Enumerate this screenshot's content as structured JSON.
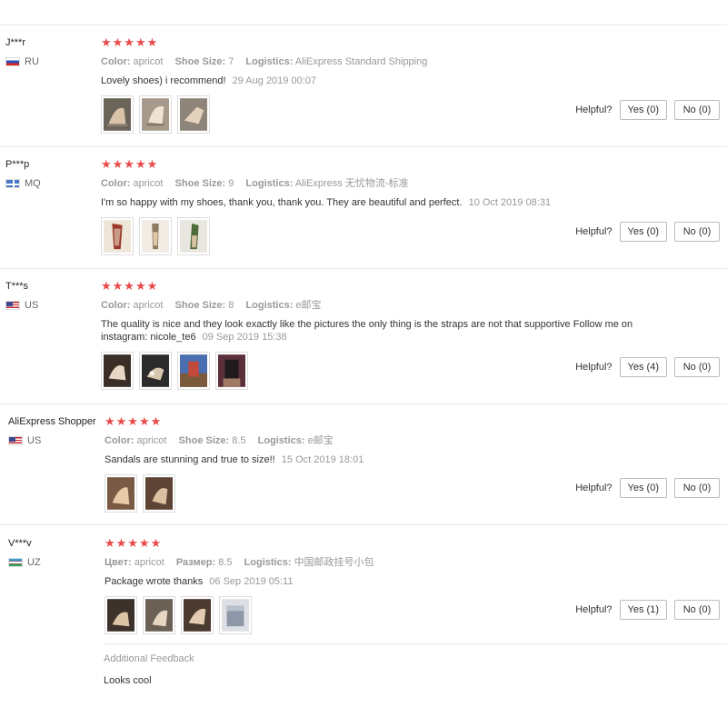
{
  "helpful_label": "Helpful?",
  "colors": {
    "star": "#e94a4a",
    "border": "#e8e8e8",
    "muted": "#999999"
  },
  "reviews": [
    {
      "user": "J***r",
      "country": "RU",
      "flag": "ru",
      "stars": "★★★★★",
      "attrs": [
        {
          "k": "Color:",
          "v": "apricot"
        },
        {
          "k": "Shoe Size:",
          "v": "7"
        },
        {
          "k": "Logistics:",
          "v": "AliExpress Standard Shipping"
        }
      ],
      "text": "Lovely shoes) i recommend!",
      "time": "29 Aug 2019 00:07",
      "photos": [
        "shoe-photo",
        "shoe-photo",
        "shoe-photo"
      ],
      "yes": "Yes (0)",
      "no": "No (0)"
    },
    {
      "user": "P***p",
      "country": "MQ",
      "flag": "mq",
      "stars": "★★★★★",
      "attrs": [
        {
          "k": "Color:",
          "v": "apricot"
        },
        {
          "k": "Shoe Size:",
          "v": "9"
        },
        {
          "k": "Logistics:",
          "v": "AliExpress 无忧物流-标准"
        }
      ],
      "text": "I'm so happy with my shoes, thank you, thank you. They are beautiful and perfect.",
      "time": "10 Oct 2019 08:31",
      "photos": [
        "shoe-photo",
        "shoe-photo",
        "shoe-photo"
      ],
      "yes": "Yes (0)",
      "no": "No (0)"
    },
    {
      "user": "T***s",
      "country": "US",
      "flag": "us",
      "stars": "★★★★★",
      "attrs": [
        {
          "k": "Color:",
          "v": "apricot"
        },
        {
          "k": "Shoe Size:",
          "v": "8"
        },
        {
          "k": "Logistics:",
          "v": "e邮宝"
        }
      ],
      "text": "The quality is nice and they look exactly like the pictures the only thing is the straps are not that supportive Follow me on instagram: nicole_te6",
      "time": "09 Sep 2019 15:38",
      "photos": [
        "shoe-photo",
        "shoe-photo",
        "shoe-photo",
        "shoe-photo"
      ],
      "yes": "Yes (4)",
      "no": "No (0)"
    },
    {
      "user": "AliExpress Shopper",
      "country": "US",
      "flag": "us",
      "stars": "★★★★★",
      "attrs": [
        {
          "k": "Color:",
          "v": "apricot"
        },
        {
          "k": "Shoe Size:",
          "v": "8.5"
        },
        {
          "k": "Logistics:",
          "v": "e邮宝"
        }
      ],
      "text": "Sandals are stunning and true to size!!",
      "time": "15 Oct 2019 18:01",
      "photos": [
        "shoe-photo",
        "shoe-photo"
      ],
      "yes": "Yes (0)",
      "no": "No (0)"
    },
    {
      "user": "V***v",
      "country": "UZ",
      "flag": "uz",
      "stars": "★★★★★",
      "attrs": [
        {
          "k": "Цвет:",
          "v": "apricot"
        },
        {
          "k": "Размер:",
          "v": "8.5"
        },
        {
          "k": "Logistics:",
          "v": "中国邮政挂号小包"
        }
      ],
      "text": "Package wrote thanks",
      "time": "06 Sep 2019 05:11",
      "photos": [
        "shoe-photo",
        "shoe-photo",
        "shoe-photo",
        "shoe-photo"
      ],
      "yes": "Yes (1)",
      "no": "No (0)",
      "additional_title": "Additional Feedback",
      "additional_text": "Looks cool"
    }
  ]
}
